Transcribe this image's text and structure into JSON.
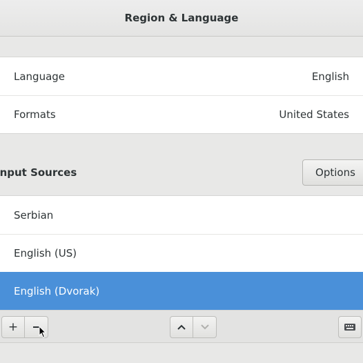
{
  "window": {
    "title": "Region & Language"
  },
  "region": {
    "rows": [
      {
        "label": "Language",
        "value": "English"
      },
      {
        "label": "Formats",
        "value": "United States"
      }
    ]
  },
  "input_sources": {
    "title": "Input Sources",
    "options_label": "Options",
    "items": [
      {
        "label": "Serbian",
        "selected": false
      },
      {
        "label": "English (US)",
        "selected": false
      },
      {
        "label": "English (Dvorak)",
        "selected": true
      }
    ],
    "selected_color": "#4a90d9"
  },
  "toolbar": {
    "add_label": "+",
    "remove_icon": "remove-icon",
    "move_up_icon": "chevron-up-icon",
    "move_down_icon": "chevron-down-icon",
    "keyboard_icon": "keyboard-icon"
  }
}
